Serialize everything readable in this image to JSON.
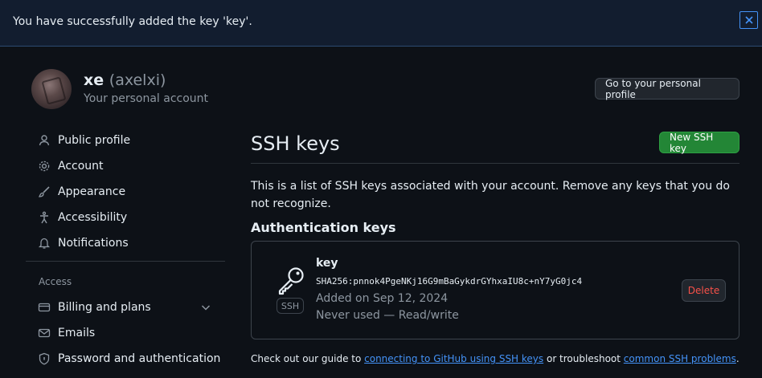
{
  "flash": {
    "message": "You have successfully added the key 'key'.",
    "close_icon": "close-icon"
  },
  "profile": {
    "name": "xe",
    "login": "(axelxi)",
    "subtitle": "Your personal account",
    "go_to_profile_label": "Go to your personal profile"
  },
  "sidebar": {
    "items": [
      {
        "label": "Public profile",
        "icon": "person-icon"
      },
      {
        "label": "Account",
        "icon": "gear-icon"
      },
      {
        "label": "Appearance",
        "icon": "paintbrush-icon"
      },
      {
        "label": "Accessibility",
        "icon": "accessibility-icon"
      },
      {
        "label": "Notifications",
        "icon": "bell-icon"
      }
    ],
    "access_heading": "Access",
    "access_items": [
      {
        "label": "Billing and plans",
        "icon": "credit-card-icon"
      },
      {
        "label": "Emails",
        "icon": "mail-icon"
      },
      {
        "label": "Password and authentication",
        "icon": "shield-icon"
      }
    ]
  },
  "main": {
    "title": "SSH keys",
    "new_key_label": "New SSH key",
    "intro": "This is a list of SSH keys associated with your account. Remove any keys that you do not recognize.",
    "section_title": "Authentication keys",
    "keys": [
      {
        "name": "key",
        "badge": "SSH",
        "fingerprint": "SHA256:pnnok4PgeNKj16G9mBaGykdrGYhxaIU8c+nY7yG0jc4",
        "added": "Added on Sep 12, 2024",
        "usage": "Never used — Read/write",
        "delete_label": "Delete"
      }
    ],
    "footer": {
      "prefix": "Check out our guide to ",
      "link1": "connecting to GitHub using SSH keys",
      "middle": " or troubleshoot ",
      "link2": "common SSH problems",
      "suffix": "."
    }
  },
  "colors": {
    "background": "#0d1117",
    "accent_link": "#4493f8",
    "primary_button": "#238636",
    "danger": "#f85149"
  }
}
